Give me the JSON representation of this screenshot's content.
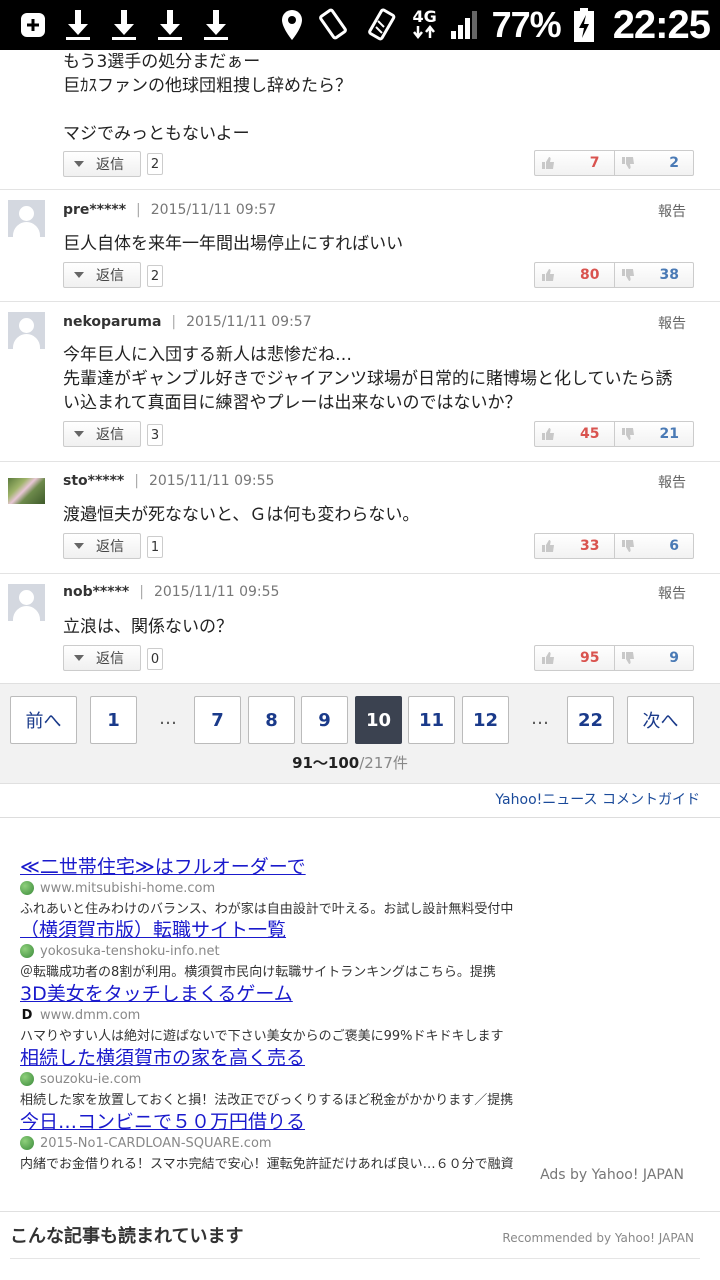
{
  "status_bar": {
    "icons": [
      "add-box-icon",
      "download-icon",
      "download-icon",
      "download-icon",
      "download-icon",
      "location-icon",
      "rotate-icon",
      "rotate-icon",
      "network-4g-icon",
      "signal-icon",
      "battery-charging-icon"
    ],
    "network": "4G",
    "battery": "77%",
    "time": "22:25"
  },
  "comments": [
    {
      "body": "もう3選手の処分まだぁー\n巨ｶｽファンの他球団粗捜し辞めたら？\n\nマジでみっともないよー",
      "reply_label": "返信",
      "reply_count": "2",
      "likes": "7",
      "dislikes": "2"
    },
    {
      "user": "pre*****",
      "date": "2015/11/11 09:57",
      "report": "報告",
      "body": "巨人自体を来年一年間出場停止にすればいい",
      "reply_label": "返信",
      "reply_count": "2",
      "likes": "80",
      "dislikes": "38"
    },
    {
      "user": "nekoparuma",
      "date": "2015/11/11 09:57",
      "report": "報告",
      "body": "今年巨人に入団する新人は悲惨だね…\n先輩達がギャンブル好きでジャイアンツ球場が日常的に賭博場と化していたら誘\nい込まれて真面目に練習やプレーは出来ないのではないか？",
      "reply_label": "返信",
      "reply_count": "3",
      "likes": "45",
      "dislikes": "21"
    },
    {
      "user": "sto*****",
      "date": "2015/11/11 09:55",
      "report": "報告",
      "body": "渡邉恒夫が死なないと、Ｇは何も変わらない。",
      "reply_label": "返信",
      "reply_count": "1",
      "likes": "33",
      "dislikes": "6"
    },
    {
      "user": "nob*****",
      "date": "2015/11/11 09:55",
      "report": "報告",
      "body": "立浪は、関係ないの？",
      "reply_label": "返信",
      "reply_count": "0",
      "likes": "95",
      "dislikes": "9"
    }
  ],
  "pagination": {
    "prev": "前へ",
    "next": "次へ",
    "pages": [
      "1",
      "7",
      "8",
      "9",
      "10",
      "11",
      "12",
      "22"
    ],
    "ellipsis": "…",
    "current_page": "10",
    "range": "91〜100",
    "total": "/217件"
  },
  "comment_guide": "Yahoo!ニュース コメントガイド",
  "ads": [
    {
      "title": "≪二世帯住宅≫はフルオーダーで",
      "url": "www.mitsubishi-home.com",
      "desc": "ふれあいと住みわけのバランス、わが家は自由設計で叶える。お試し設計無料受付中"
    },
    {
      "title": "（横須賀市版）転職サイト一覧",
      "url": "yokosuka-tenshoku-info.net",
      "desc": "＠転職成功者の8割が利用。横須賀市民向け転職サイトランキングはこちら。提携"
    },
    {
      "title": "3D美女をタッチしまくるゲーム",
      "url": "www.dmm.com",
      "desc": "ハマりやすい人は絶対に遊ばないで下さい美女からのご褒美に99%ドキドキします"
    },
    {
      "title": "相続した横須賀市の家を高く売る",
      "url": "souzoku-ie.com",
      "desc": "相続した家を放置しておくと損！法改正でびっくりするほど税金がかかります／提携"
    },
    {
      "title": "今日…コンビニで５０万円借りる",
      "url": "2015-No1-CARDLOAN-SQUARE.com",
      "desc": "内緒でお金借りれる！スマホ完結で安心！運転免許証だけあれば良い…６０分で融資"
    }
  ],
  "ads_by": "Ads by Yahoo! JAPAN",
  "section_title": "こんな記事も読まれています",
  "recommended": "Recommended by Yahoo! JAPAN"
}
